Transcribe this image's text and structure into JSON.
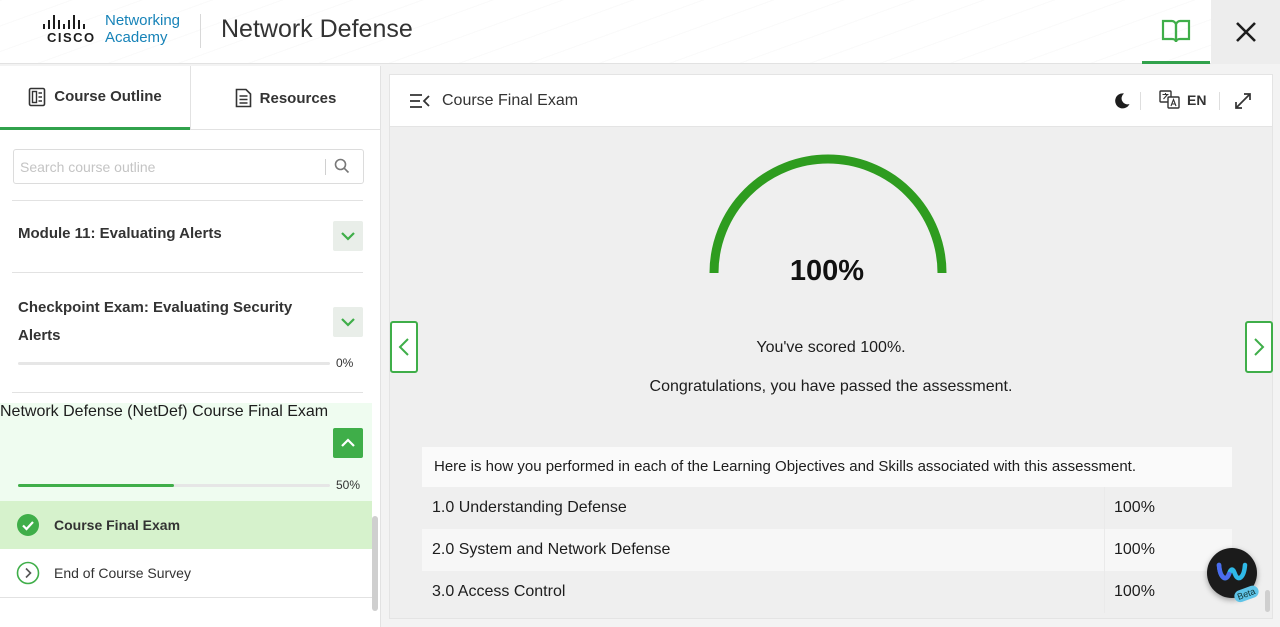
{
  "header": {
    "brand_cisco": "CISCO",
    "brand_line1": "Networking",
    "brand_line2": "Academy",
    "title": "Network Defense"
  },
  "sidebar": {
    "tabs": [
      {
        "label": "Course Outline",
        "active": true
      },
      {
        "label": "Resources",
        "active": false
      }
    ],
    "search_placeholder": "Search course outline",
    "modules": [
      {
        "title": "Module 11: Evaluating Alerts",
        "expanded": false
      },
      {
        "title": "Checkpoint Exam: Evaluating Security Alerts",
        "expanded": false,
        "progress_label": "0%",
        "progress": 0
      },
      {
        "title": "Network Defense (NetDef) Course Final Exam",
        "expanded": true,
        "progress_label": "50%",
        "progress": 0.5
      }
    ],
    "items": [
      {
        "label": "Course Final Exam",
        "status": "completed"
      },
      {
        "label": "End of Course Survey",
        "status": "pending"
      }
    ]
  },
  "content": {
    "title": "Course Final Exam",
    "language": "EN",
    "score_label": "100%",
    "score": 1.0,
    "message1": "You've scored 100%.",
    "message2": "Congratulations, you have passed the assessment.",
    "table_header": "Here is how you performed in each of the Learning Objectives and Skills associated with this assessment.",
    "rows": [
      {
        "name": "1.0 Understanding Defense",
        "value": "100%"
      },
      {
        "name": "2.0 System and Network Defense",
        "value": "100%"
      },
      {
        "name": "3.0 Access Control",
        "value": "100%"
      }
    ]
  },
  "widget": {
    "badge": "Beta"
  },
  "colors": {
    "accent": "#3fae49",
    "gauge": "#2e9c1f",
    "brand_blue": "#1783b8"
  }
}
